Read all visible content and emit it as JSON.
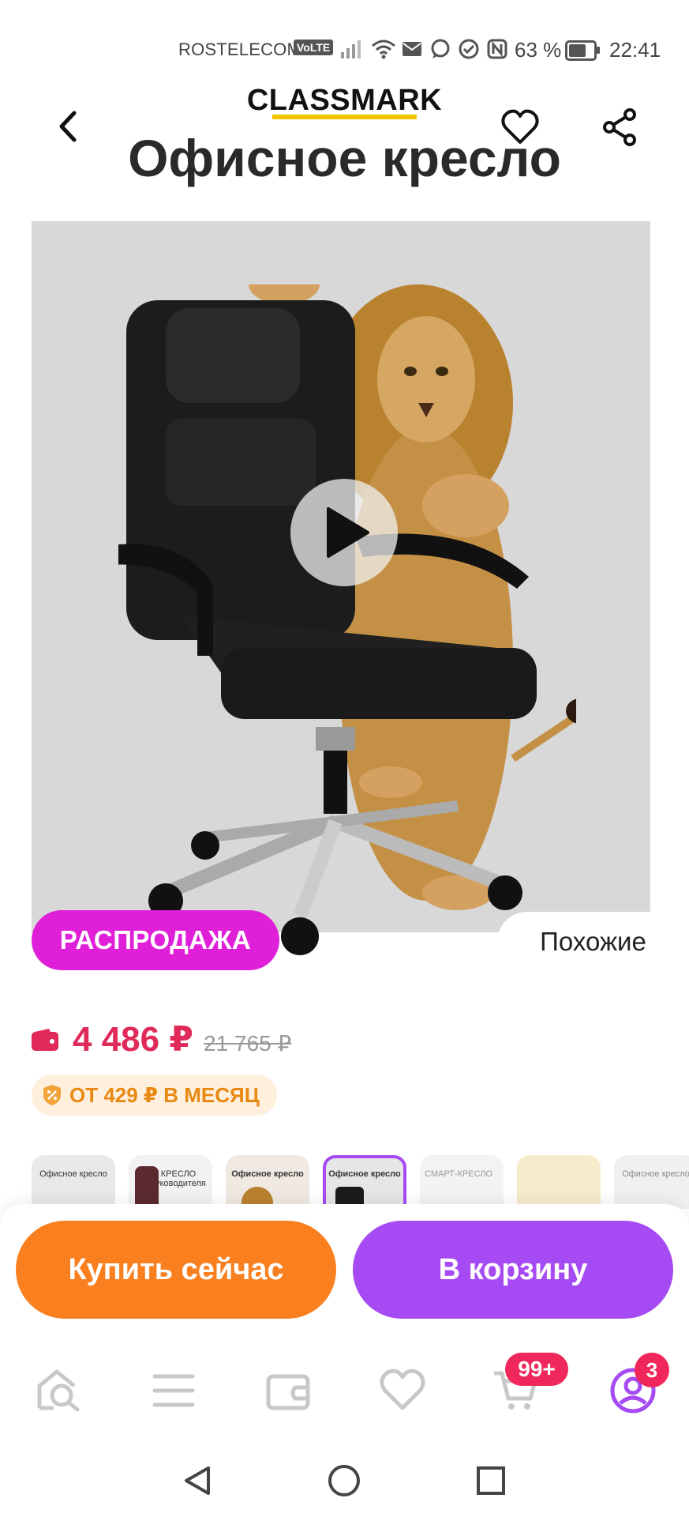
{
  "status_bar": {
    "carrier": "ROSTELECOM",
    "volte": "VoLTE",
    "battery_pct": "63 %",
    "battery_level": 0.63,
    "time": "22:41"
  },
  "header": {
    "back_icon": "chevron-left-icon",
    "favorite_icon": "heart-icon",
    "share_icon": "share-icon"
  },
  "product_image": {
    "brand": "CLASSMARK",
    "title": "Офисное кресло",
    "play_icon": "play-icon"
  },
  "badges": {
    "sale": "РАСПРОДАЖА",
    "similar": "Похожие"
  },
  "price": {
    "current": "4 486 ₽",
    "old": "21 765 ₽",
    "installment": "ОТ 429 ₽ В МЕСЯЦ"
  },
  "thumbnails": [
    {
      "label": "Офисное кресло"
    },
    {
      "label": "КРЕСЛО руководителя"
    },
    {
      "label": "Офисное кресло"
    },
    {
      "label": "Офисное кресло"
    },
    {
      "label": "СМАРТ-КРЕСЛО"
    },
    {
      "label": ""
    },
    {
      "label": "Офисное кресло"
    }
  ],
  "actions": {
    "buy_now": "Купить сейчас",
    "to_cart": "В корзину"
  },
  "bottom_nav": {
    "cart_badge": "99+",
    "profile_badge": "3"
  },
  "colors": {
    "accent_purple": "#a64bf4",
    "accent_orange": "#fa7f1e",
    "sale_magenta": "#e020d8",
    "price_red": "#e02a5a"
  }
}
